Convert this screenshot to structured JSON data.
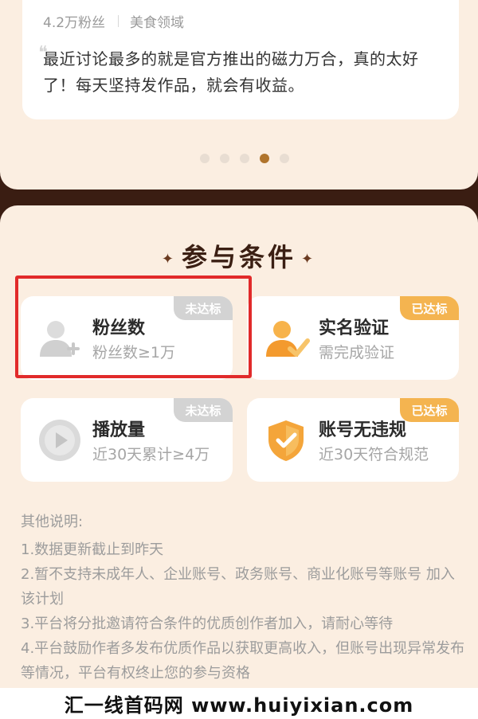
{
  "testimonial": {
    "followers": "4.2万粉丝",
    "domain": "美食领域",
    "text": "最近讨论最多的就是官方推出的磁力万合，真的太好了！每天坚持发作品，就会有收益。"
  },
  "carousel": {
    "count": 5,
    "active_index": 3
  },
  "conditions": {
    "title": "参与条件",
    "cards": [
      {
        "title": "粉丝数",
        "subtitle": "粉丝数≥1万",
        "status": "未达标",
        "icon": "user-add-icon"
      },
      {
        "title": "实名验证",
        "subtitle": "需完成验证",
        "status": "已达标",
        "icon": "user-check-icon"
      },
      {
        "title": "播放量",
        "subtitle": "近30天累计≥4万",
        "status": "未达标",
        "icon": "play-icon"
      },
      {
        "title": "账号无违规",
        "subtitle": "近30天符合规范",
        "status": "已达标",
        "icon": "shield-check-icon"
      }
    ]
  },
  "notes": {
    "title": "其他说明:",
    "items": [
      "1.数据更新截止到昨天",
      "2.暂不支持未成年人、企业账号、政务账号、商业化账号等账号 加入该计划",
      "3.平台将分批邀请符合条件的优质创作者加入，请耐心等待",
      "4.平台鼓励作者多发布优质作品以获取更高收入，但账号出现异常发布等情况，平台有权终止您的参与资格"
    ]
  },
  "watermark": "汇一线首码网 www.huiyixian.com",
  "colors": {
    "accent": "#f4b450",
    "unmet": "#d3d3d3",
    "highlight": "#e12a2a",
    "panel": "#fbeee1",
    "background": "#3a1d12"
  }
}
